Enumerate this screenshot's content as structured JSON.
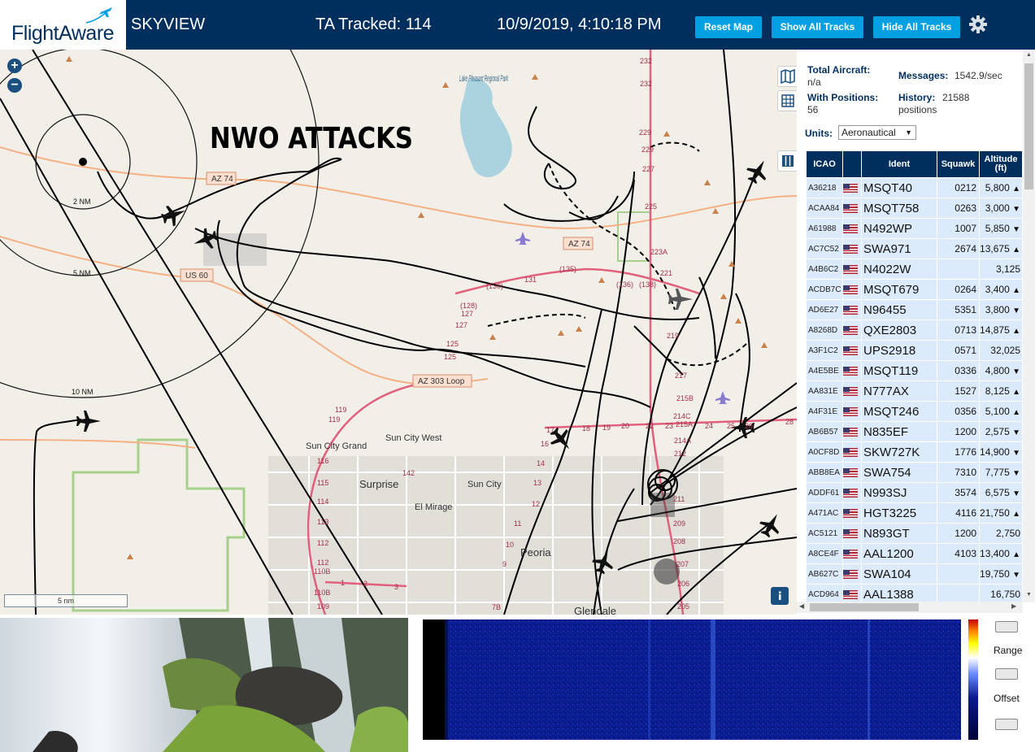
{
  "header": {
    "logo_text": "FlightAware",
    "app_title": "SKYVIEW",
    "tracked": "TA Tracked: 114",
    "datetime": "10/9/2019, 4:10:18 PM",
    "buttons": {
      "reset": "Reset Map",
      "show": "Show All Tracks",
      "hide": "Hide All Tracks"
    },
    "accent": "#00a0e2",
    "bar_color": "#002f5d"
  },
  "map": {
    "overlay_text": "NWO ATTACKS",
    "range_rings": [
      "2 NM",
      "5 NM",
      "10 NM"
    ],
    "scale": "5 nm",
    "road_labels": [
      "AZ 74",
      "AZ 74",
      "US 60",
      "AZ 303 Loop"
    ],
    "places": [
      "Lake Pleasant Regional Park",
      "Sun City Grand",
      "Sun City West",
      "Surprise",
      "Sun City",
      "El Mirage",
      "Peoria",
      "Glendale"
    ],
    "route_numbers": [
      "232",
      "232",
      "229",
      "229",
      "227",
      "225",
      "223A",
      "221",
      "219",
      "217",
      "215B",
      "214C",
      "215A",
      "214A",
      "212",
      "211",
      "209",
      "208",
      "207",
      "206",
      "205",
      "(130)",
      "131",
      "(135)",
      "(136)",
      "(138)",
      "(128)",
      "127",
      "127",
      "125",
      "125",
      "119",
      "119",
      "116",
      "115",
      "114",
      "113",
      "112",
      "112",
      "110B",
      "110B",
      "109",
      "1",
      "2",
      "3",
      "142",
      "17",
      "18",
      "19",
      "20",
      "22",
      "23",
      "24",
      "25",
      "26",
      "28",
      "16",
      "14",
      "13",
      "12",
      "11",
      "10",
      "9",
      "7B"
    ],
    "tools": [
      "map-layers-icon",
      "grid-icon",
      "columns-icon",
      "info-icon"
    ]
  },
  "panel": {
    "total_aircraft_label": "Total Aircraft:",
    "total_aircraft_value": "n/a",
    "messages_label": "Messages:",
    "messages_value": "1542.9/sec",
    "with_positions_label": "With Positions:",
    "with_positions_value": "56",
    "history_label": "History:",
    "history_value": "21588",
    "history_unit": "positions",
    "units_label": "Units:",
    "units_value": "Aeronautical",
    "columns": [
      "ICAO",
      "Ident",
      "Squawk",
      "Altitude (ft)"
    ],
    "rows": [
      {
        "icao": "A36218",
        "ident": "MSQT40",
        "squawk": "0212",
        "alt": "5,800",
        "trend": "▲"
      },
      {
        "icao": "ACAA84",
        "ident": "MSQT758",
        "squawk": "0263",
        "alt": "3,000",
        "trend": "▼"
      },
      {
        "icao": "A61988",
        "ident": "N492WP",
        "squawk": "1007",
        "alt": "5,850",
        "trend": "▼"
      },
      {
        "icao": "AC7C52",
        "ident": "SWA971",
        "squawk": "2674",
        "alt": "13,675",
        "trend": "▲"
      },
      {
        "icao": "A4B6C2",
        "ident": "N4022W",
        "squawk": "",
        "alt": "3,125",
        "trend": ""
      },
      {
        "icao": "ACDB7C",
        "ident": "MSQT679",
        "squawk": "0264",
        "alt": "3,400",
        "trend": "▲"
      },
      {
        "icao": "AD6E27",
        "ident": "N96455",
        "squawk": "5351",
        "alt": "3,800",
        "trend": "▼"
      },
      {
        "icao": "A8268D",
        "ident": "QXE2803",
        "squawk": "0713",
        "alt": "14,875",
        "trend": "▲"
      },
      {
        "icao": "A3F1C2",
        "ident": "UPS2918",
        "squawk": "0571",
        "alt": "32,025",
        "trend": ""
      },
      {
        "icao": "A4E5BE",
        "ident": "MSQT119",
        "squawk": "0336",
        "alt": "4,800",
        "trend": "▼"
      },
      {
        "icao": "AA831E",
        "ident": "N777AX",
        "squawk": "1527",
        "alt": "8,125",
        "trend": "▲"
      },
      {
        "icao": "A4F31E",
        "ident": "MSQT246",
        "squawk": "0356",
        "alt": "5,100",
        "trend": "▲"
      },
      {
        "icao": "AB6B57",
        "ident": "N835EF",
        "squawk": "1200",
        "alt": "2,575",
        "trend": "▼"
      },
      {
        "icao": "A0CF8D",
        "ident": "SKW727K",
        "squawk": "1776",
        "alt": "14,900",
        "trend": "▼"
      },
      {
        "icao": "ABB8EA",
        "ident": "SWA754",
        "squawk": "7310",
        "alt": "7,775",
        "trend": "▼"
      },
      {
        "icao": "ADDF61",
        "ident": "N993SJ",
        "squawk": "3574",
        "alt": "6,575",
        "trend": "▼"
      },
      {
        "icao": "A471AC",
        "ident": "HGT3225",
        "squawk": "4116",
        "alt": "21,750",
        "trend": "▲"
      },
      {
        "icao": "AC5121",
        "ident": "N893GT",
        "squawk": "1200",
        "alt": "2,750",
        "trend": ""
      },
      {
        "icao": "A8CE4F",
        "ident": "AAL1200",
        "squawk": "4103",
        "alt": "13,400",
        "trend": "▲"
      },
      {
        "icao": "AB627C",
        "ident": "SWA104",
        "squawk": "",
        "alt": "19,750",
        "trend": "▼"
      },
      {
        "icao": "ACD964",
        "ident": "AAL1388",
        "squawk": "",
        "alt": "16,750",
        "trend": ""
      }
    ]
  },
  "spectrogram": {
    "range_label": "Range",
    "offset_label": "Offset"
  }
}
